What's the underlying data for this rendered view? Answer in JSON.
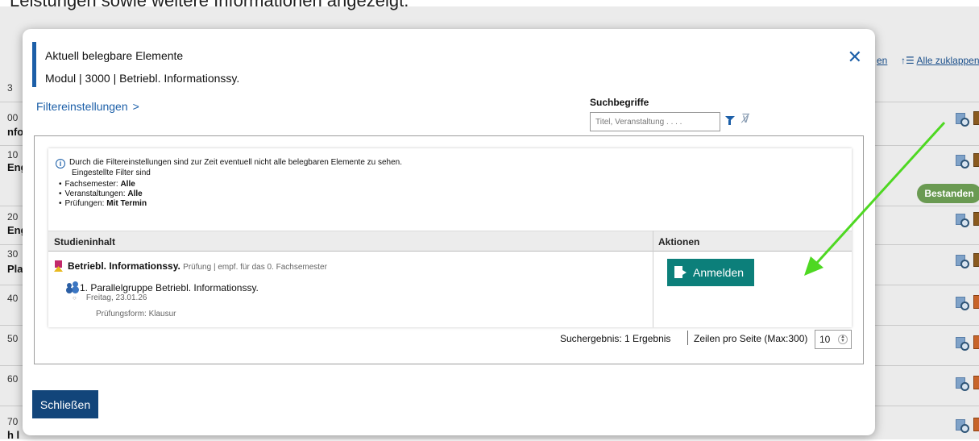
{
  "caption": "Leistungen sowie weitere Informationen angezeigt.",
  "background": {
    "links": [
      "en",
      "Alle zuklappen"
    ],
    "row_numbers": [
      "3",
      "00",
      "10",
      "20",
      "30",
      "40",
      "50",
      "60",
      "70"
    ],
    "row_labels": [
      "nfo",
      "Eng",
      "Eng",
      "Pla",
      "h l"
    ],
    "badge": "Bestanden"
  },
  "modal": {
    "title_line1": "Aktuell belegbare Elemente",
    "title_line2": "Modul | 3000 | Betriebl. Informationssy.",
    "close_symbol": "✕",
    "filter_link": "Filtereinstellungen",
    "filter_chevron": ">",
    "search": {
      "label": "Suchbegriffe",
      "placeholder": "Titel, Veranstaltung . . . ."
    },
    "info": {
      "line1": "Durch die Filtereinstellungen sind zur Zeit eventuell nicht alle belegbaren Elemente zu sehen.",
      "line2": "Eingestellte Filter sind",
      "filters": [
        {
          "key": "Fachsemester:",
          "value": "Alle"
        },
        {
          "key": "Veranstaltungen:",
          "value": "Alle"
        },
        {
          "key": "Prüfungen:",
          "value": "Mit Termin"
        }
      ]
    },
    "table": {
      "col1": "Studieninhalt",
      "col2": "Aktionen",
      "row": {
        "title": "Betriebl. Informationssy.",
        "meta": "Prüfung | empf. für das 0. Fachsemester",
        "group": "1. Parallelgruppe Betriebl. Informationssy.",
        "date": "Freitag, 23.01.26",
        "pruefungsform": "Prüfungsform: Klausur",
        "action": "Anmelden"
      }
    },
    "footer": {
      "result": "Suchergebnis: 1 Ergebnis",
      "rows_label": "Zeilen pro Seite (Max:300)",
      "rows_value": "10"
    },
    "close_button": "Schließen"
  },
  "colors": {
    "primary_blue": "#1c5fa8",
    "register_teal": "#0c7f7a",
    "close_navy": "#12457a",
    "arrow_green": "#4ed822",
    "badge_green": "#6a9a52"
  }
}
